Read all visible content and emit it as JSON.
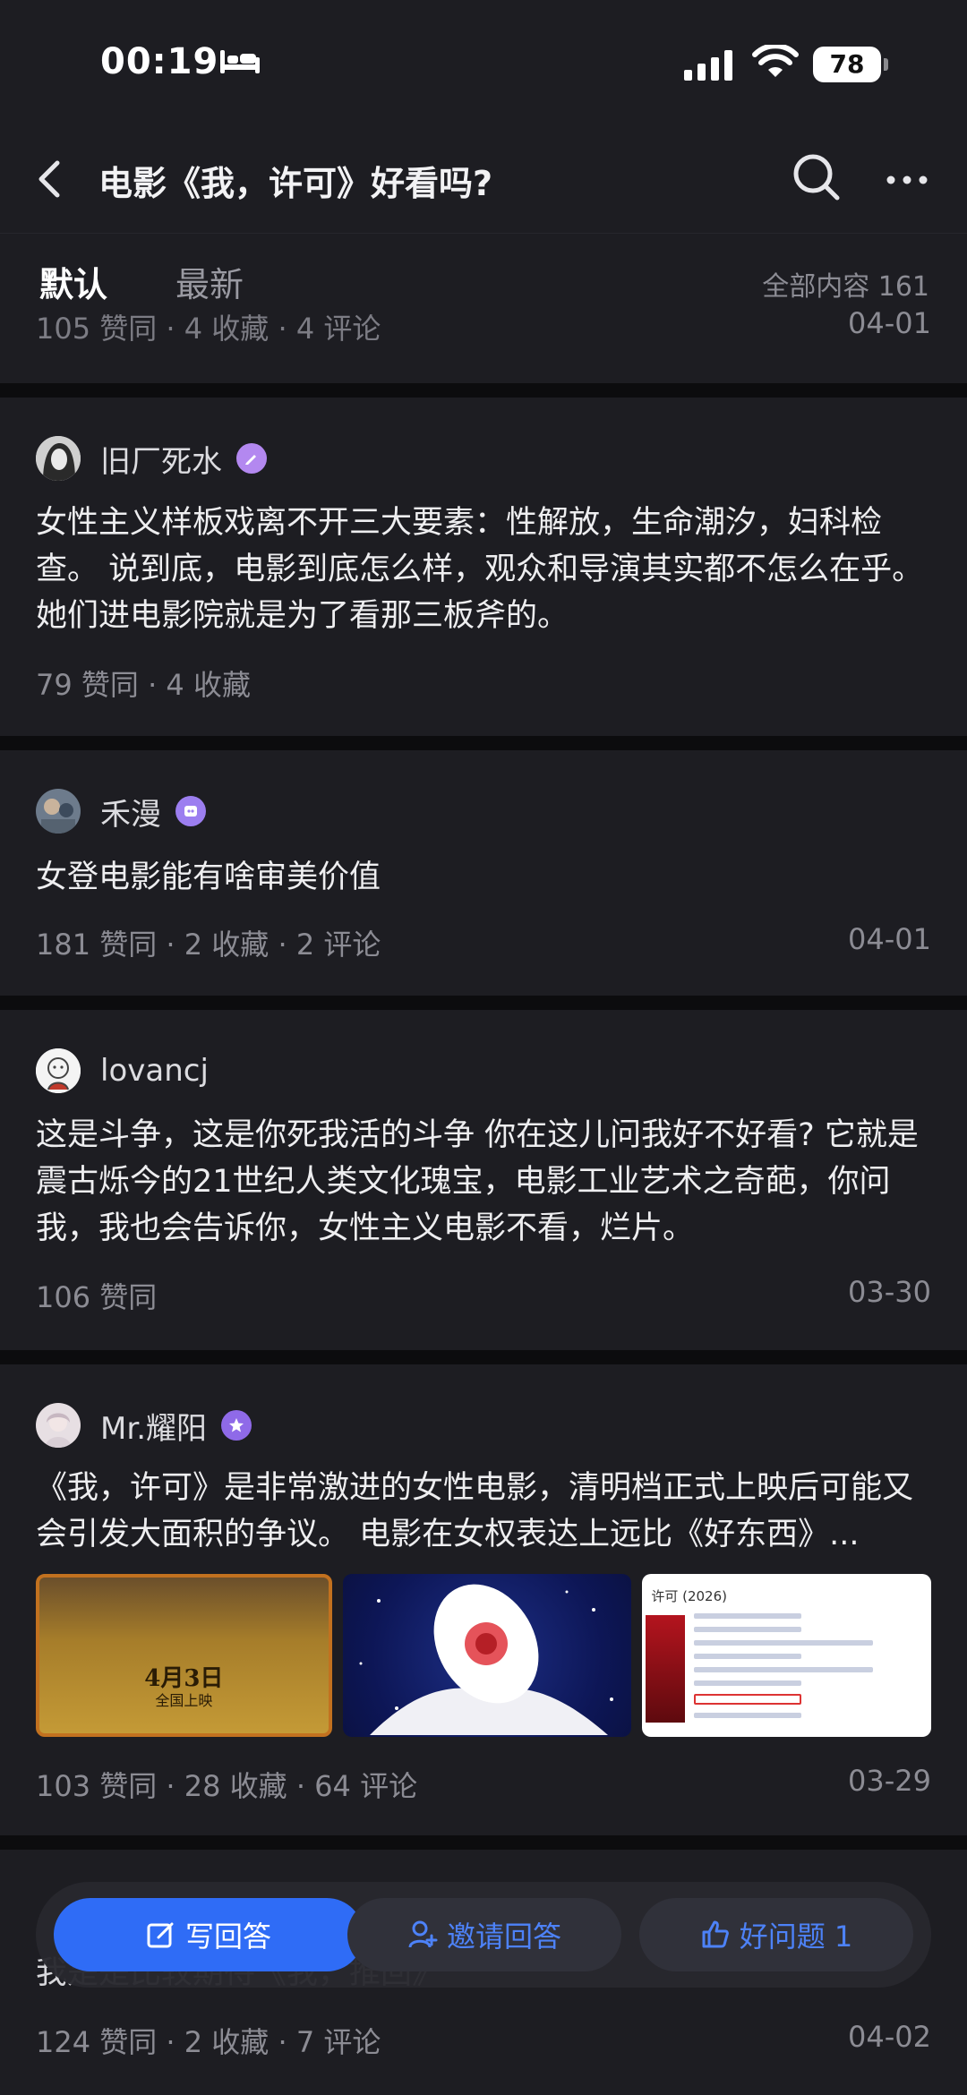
{
  "status_bar": {
    "time": "00:19",
    "battery": "78"
  },
  "header": {
    "title": "电影《我，许可》好看吗?"
  },
  "tabs": {
    "default": "默认",
    "latest": "最新",
    "total": "全部内容 161"
  },
  "answers": [
    {
      "meta": "105 赞同 · 4 收藏 · 4 评论",
      "date": "04-01"
    },
    {
      "author": "旧厂死水",
      "content": "女性主义样板戏离不开三大要素：性解放，生命潮汐，妇科检查。 说到底，电影到底怎么样，观众和导演其实都不怎么在乎。 她们进电影院就是为了看那三板斧的。",
      "meta": "79 赞同 · 4 收藏"
    },
    {
      "author": "禾漫",
      "content": "女登电影能有啥审美价值",
      "meta": "181 赞同 · 2 收藏 · 2 评论",
      "date": "04-01"
    },
    {
      "author": "lovancj",
      "content": "这是斗争，这是你死我活的斗争 你在这儿问我好不好看? 它就是震古烁今的21世纪人类文化瑰宝，电影工业艺术之奇葩，你问我，我也会告诉你，女性主义电影不看，烂片。",
      "meta": "106 赞同",
      "date": "03-30"
    },
    {
      "author": "Mr.耀阳",
      "content": "《我，许可》是非常激进的女性电影，清明档正式上映后可能又会引发大面积的争议。 电影在女权表达上远比《好东西》...",
      "meta": "103 赞同 · 28 收藏 · 64 评论",
      "date": "03-29",
      "thumb_poster_date": "4月3日",
      "thumb_poster_sub": "全国上映",
      "thumb_info_title": "许可 (2026)"
    },
    {
      "content": "我是是比较期待《我，推回》",
      "meta": "124 赞同 · 2 收藏 · 7 评论",
      "date": "04-02"
    }
  ],
  "bottom_bar": {
    "write": "写回答",
    "invite": "邀请回答",
    "good": "好问题 1"
  },
  "colors": {
    "accent": "#2f6cf6",
    "card": "#1d1d22",
    "background": "#0c0c0e"
  }
}
